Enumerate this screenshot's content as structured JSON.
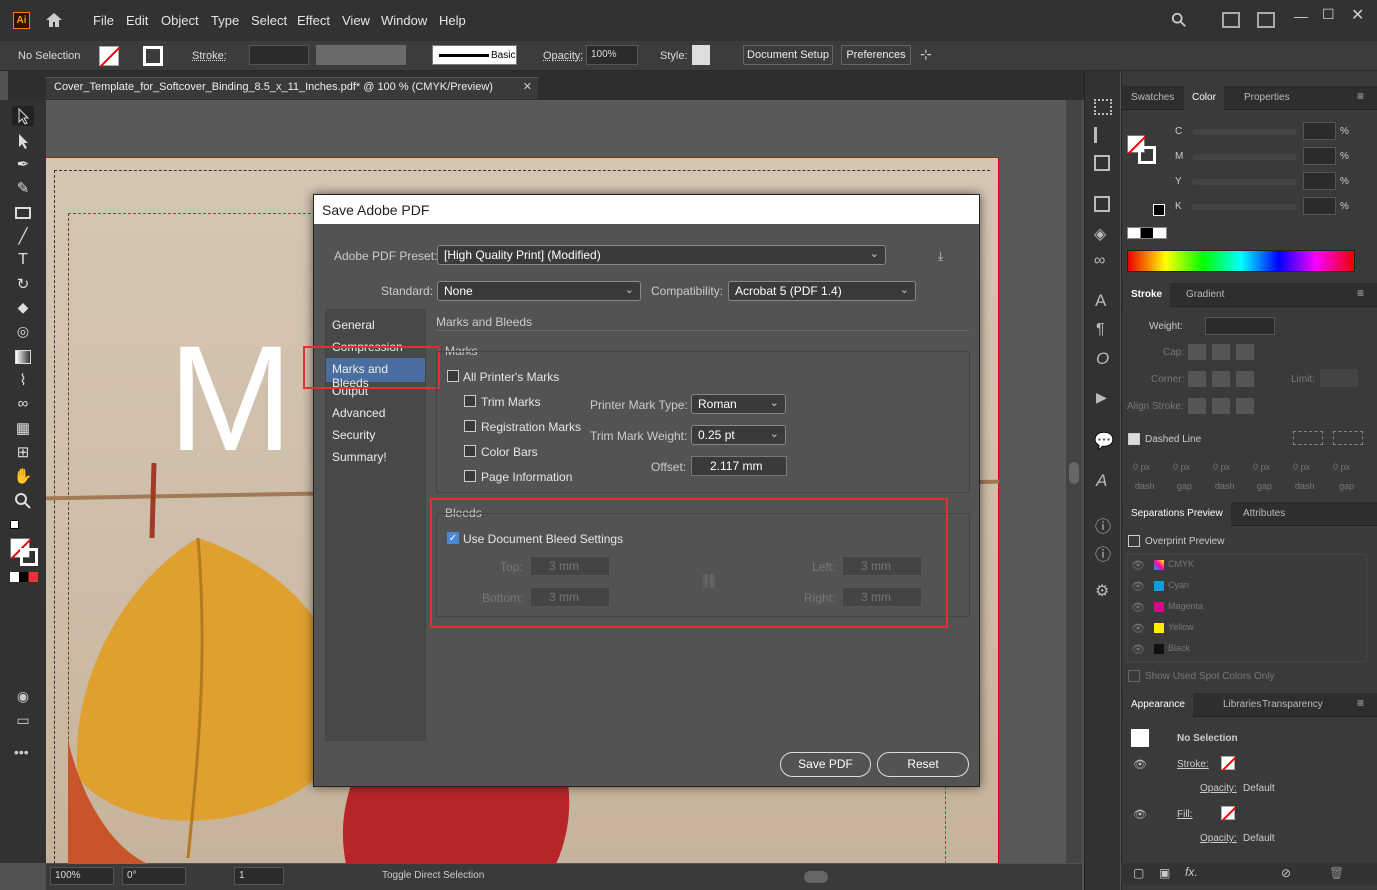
{
  "menubar": {
    "logo": "Ai",
    "items": [
      "File",
      "Edit",
      "Object",
      "Type",
      "Select",
      "Effect",
      "View",
      "Window",
      "Help"
    ]
  },
  "control": {
    "selection": "No Selection",
    "stroke_label": "Stroke:",
    "brush": "Basic",
    "opacity_label": "Opacity:",
    "opacity": "100%",
    "style_label": "Style:",
    "doc_setup": "Document Setup",
    "preferences": "Preferences"
  },
  "doc": {
    "tab_title": "Cover_Template_for_Softcover_Binding_8.5_x_11_Inches.pdf* @ 100 % (CMYK/Preview)"
  },
  "artboard": {
    "big_letter": "M"
  },
  "status": {
    "zoom": "100%",
    "rotation": "0°",
    "page": "1",
    "message": "Toggle Direct Selection"
  },
  "color_panel": {
    "tabs": [
      "Swatches",
      "Color",
      "Properties"
    ],
    "channels": [
      "C",
      "M",
      "Y",
      "K"
    ],
    "unit": "%"
  },
  "stroke_panel": {
    "tabs": [
      "Stroke",
      "Gradient"
    ],
    "weight": "Weight:",
    "cap": "Cap:",
    "corner": "Corner:",
    "limit": "Limit:",
    "align": "Align Stroke:",
    "dashed": "Dashed Line",
    "dash_values": [
      "0 px",
      "0 px",
      "0 px",
      "0 px",
      "0 px",
      "0 px"
    ],
    "dash_labels": [
      "dash",
      "gap",
      "dash",
      "gap",
      "dash",
      "gap"
    ]
  },
  "sep_panel": {
    "tabs": [
      "Separations Preview",
      "Attributes"
    ],
    "overprint": "Overprint Preview",
    "inks": [
      "CMYK",
      "Cyan",
      "Magenta",
      "Yellow",
      "Black"
    ],
    "spot": "Show Used Spot Colors Only"
  },
  "appearance": {
    "tabs": [
      "Appearance",
      "Libraries",
      "Transparency"
    ],
    "title": "No Selection",
    "stroke": "Stroke:",
    "fill": "Fill:",
    "opacity": "Opacity:",
    "default": "Default"
  },
  "dialog": {
    "title": "Save Adobe PDF",
    "preset_label": "Adobe PDF Preset:",
    "preset": "[High Quality Print] (Modified)",
    "standard_label": "Standard:",
    "standard": "None",
    "compat_label": "Compatibility:",
    "compat": "Acrobat 5 (PDF 1.4)",
    "nav": [
      "General",
      "Compression",
      "Marks and Bleeds",
      "Output",
      "Advanced",
      "Security",
      "Summary!"
    ],
    "section": "Marks and Bleeds",
    "marks": "Marks",
    "all_marks": "All Printer's Marks",
    "trim": "Trim Marks",
    "reg": "Registration Marks",
    "colorbars": "Color Bars",
    "pageinfo": "Page Information",
    "mark_type_label": "Printer Mark Type:",
    "mark_type": "Roman",
    "trim_weight_label": "Trim Mark Weight:",
    "trim_weight": "0.25 pt",
    "offset_label": "Offset:",
    "offset": "2.117 mm",
    "bleeds": "Bleeds",
    "use_doc": "Use Document Bleed Settings",
    "top": "Top:",
    "bottom": "Bottom:",
    "left": "Left:",
    "right": "Right:",
    "bleed_val": "3 mm",
    "save": "Save PDF",
    "reset": "Reset"
  }
}
